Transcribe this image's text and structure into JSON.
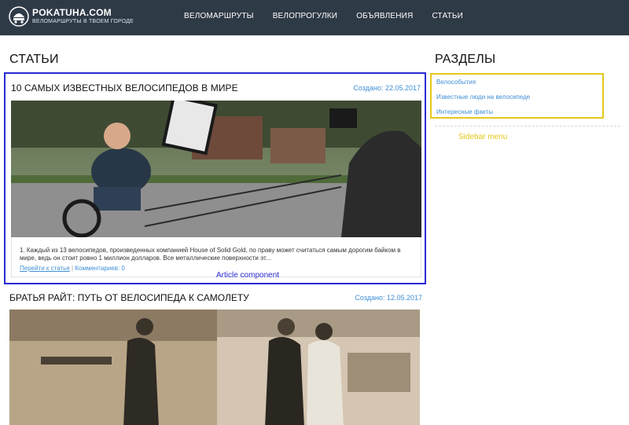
{
  "header": {
    "logo_title": "POKATUHA.COM",
    "logo_subtitle": "ВЕЛОМАРШРУТЫ В ТВОЕМ ГОРОДЕ",
    "nav": [
      "ВЕЛОМАРШРУТЫ",
      "ВЕЛОПРОГУЛКИ",
      "ОБЪЯВЛЕНИЯ",
      "СТАТЬИ"
    ]
  },
  "main": {
    "page_title": "СТАТЬИ",
    "articles": [
      {
        "title": "10 САМЫХ ИЗВЕСТНЫХ ВЕЛОСИПЕДОВ В МИРЕ",
        "date": "Создано: 22.05.2017",
        "excerpt": "1. Каждый из 13 велосипедов, произведенных компанией House of Solid Gold, по праву может считаться самым дорогим байком в мире, ведь он стоит ровно 1 миллион долларов. Все металлические поверхности эт...",
        "read_more": "Перейти к статье",
        "separator": "|",
        "comments": "Комментариев: 0",
        "annotation": "Article component"
      },
      {
        "title": "БРАТЬЯ РАЙТ: ПУТЬ ОТ ВЕЛОСИПЕДА К САМОЛЕТУ",
        "date": "Создано: 12.05.2017"
      }
    ]
  },
  "sidebar": {
    "title": "РАЗДЕЛЫ",
    "items": [
      "Велособытия",
      "Известные люди на велосипеде",
      "Интересные факты"
    ],
    "annotation": "Sidebar menu"
  },
  "colors": {
    "header_bg": "#2f3a47",
    "link": "#3f8fd6",
    "article_annotation": "#2a2ad2",
    "sidebar_annotation": "#e5c81a"
  },
  "icons": [
    "bike-helmet-logo-icon"
  ]
}
